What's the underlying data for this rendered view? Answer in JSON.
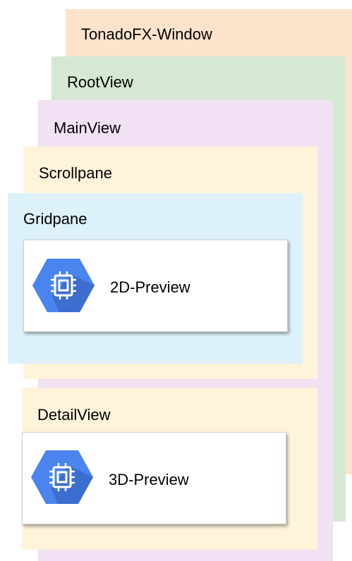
{
  "colors": {
    "window": "#fde2cc",
    "root": "#d6e8d4",
    "main": "#f0e2f3",
    "scroll": "#fff3da",
    "grid": "#ddf1fb",
    "detail": "#fff3da",
    "icon_blue": "#4a84ee",
    "icon_shadow": "#3c6ecf"
  },
  "layers": {
    "window_title": "TonadoFX-Window",
    "root_title": "RootView",
    "main_title": "MainView",
    "scroll_title": "Scrollpane",
    "grid_title": "Gridpane",
    "detail_title": "DetailView"
  },
  "cards": {
    "preview_2d": {
      "label": "2D-Preview",
      "icon": "chip-icon"
    },
    "preview_3d": {
      "label": "3D-Preview",
      "icon": "chip-icon"
    }
  }
}
